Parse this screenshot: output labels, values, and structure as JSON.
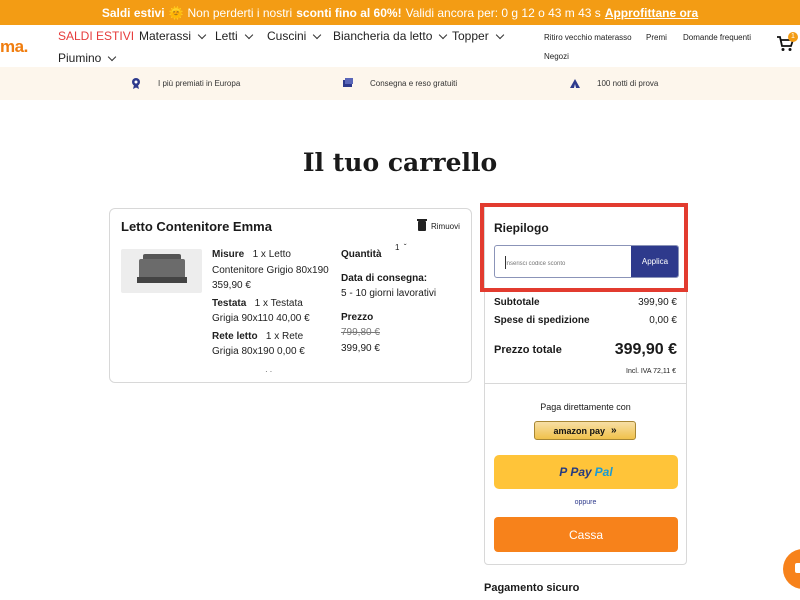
{
  "promo": {
    "label": "Saldi estivi",
    "emoji": "🌞",
    "text_pre": "Non perderti i nostri",
    "highlight": "sconti fino al 60%!",
    "countdown": "Validi ancora per: 0 g 12 o 43 m 43 s",
    "cta": "Approfittane ora"
  },
  "nav": {
    "logo": "ma.",
    "items": [
      "SALDI ESTIVI",
      "Materassi",
      "Letti",
      "Cuscini",
      "Biancheria da letto",
      "Topper",
      "Piumino"
    ],
    "utility": [
      "Ritiro vecchio materasso",
      "Premi",
      "Domande frequenti",
      "Negozi"
    ],
    "cart_count": "1"
  },
  "benefits": [
    "I più premiati in Europa",
    "Consegna e reso gratuiti",
    "100 notti di prova"
  ],
  "page_title": "Il tuo carrello",
  "cart": {
    "product_title": "Letto Contenitore Emma",
    "remove_label": "Rimuovi",
    "specs": [
      {
        "label": "Misure",
        "text": "1 x Letto Contenitore Grigio 80x190 359,90 €"
      },
      {
        "label": "Testata",
        "text": "1 x Testata Grigia 90x110 40,00 €"
      },
      {
        "label": "Rete letto",
        "text": "1 x Rete Grigia 80x190 0,00 €"
      }
    ],
    "quantity_label": "Quantità",
    "quantity_value": "1",
    "delivery_label": "Data di consegna:",
    "delivery_value": "5 - 10 giorni lavorativi",
    "price_label": "Prezzo",
    "price_old": "799,80 €",
    "price_new": "399,90 €"
  },
  "summary": {
    "title": "Riepilogo",
    "coupon_placeholder": "Inserisci codice sconto",
    "apply_label": "Applica",
    "subtotal_label": "Subtotale",
    "subtotal_value": "399,90 €",
    "shipping_label": "Spese di spedizione",
    "shipping_value": "0,00 €",
    "total_label": "Prezzo totale",
    "total_value": "399,90 €",
    "vat_note": "Incl. IVA 72,11 €",
    "direct_pay": "Paga direttamente con",
    "amazon_label": "amazon pay",
    "paypal_p": "Pay",
    "paypal_pal": "Pal",
    "or_label": "oppure",
    "checkout_label": "Cassa"
  },
  "secure_payment": "Pagamento sicuro",
  "colors": {
    "promo_bg": "#f39c14",
    "brand_orange": "#f7821b",
    "sale_red": "#e63b3b",
    "apply_blue": "#2e3a8c",
    "paypal_yellow": "#ffc439",
    "highlight_red": "#e23b2f"
  }
}
